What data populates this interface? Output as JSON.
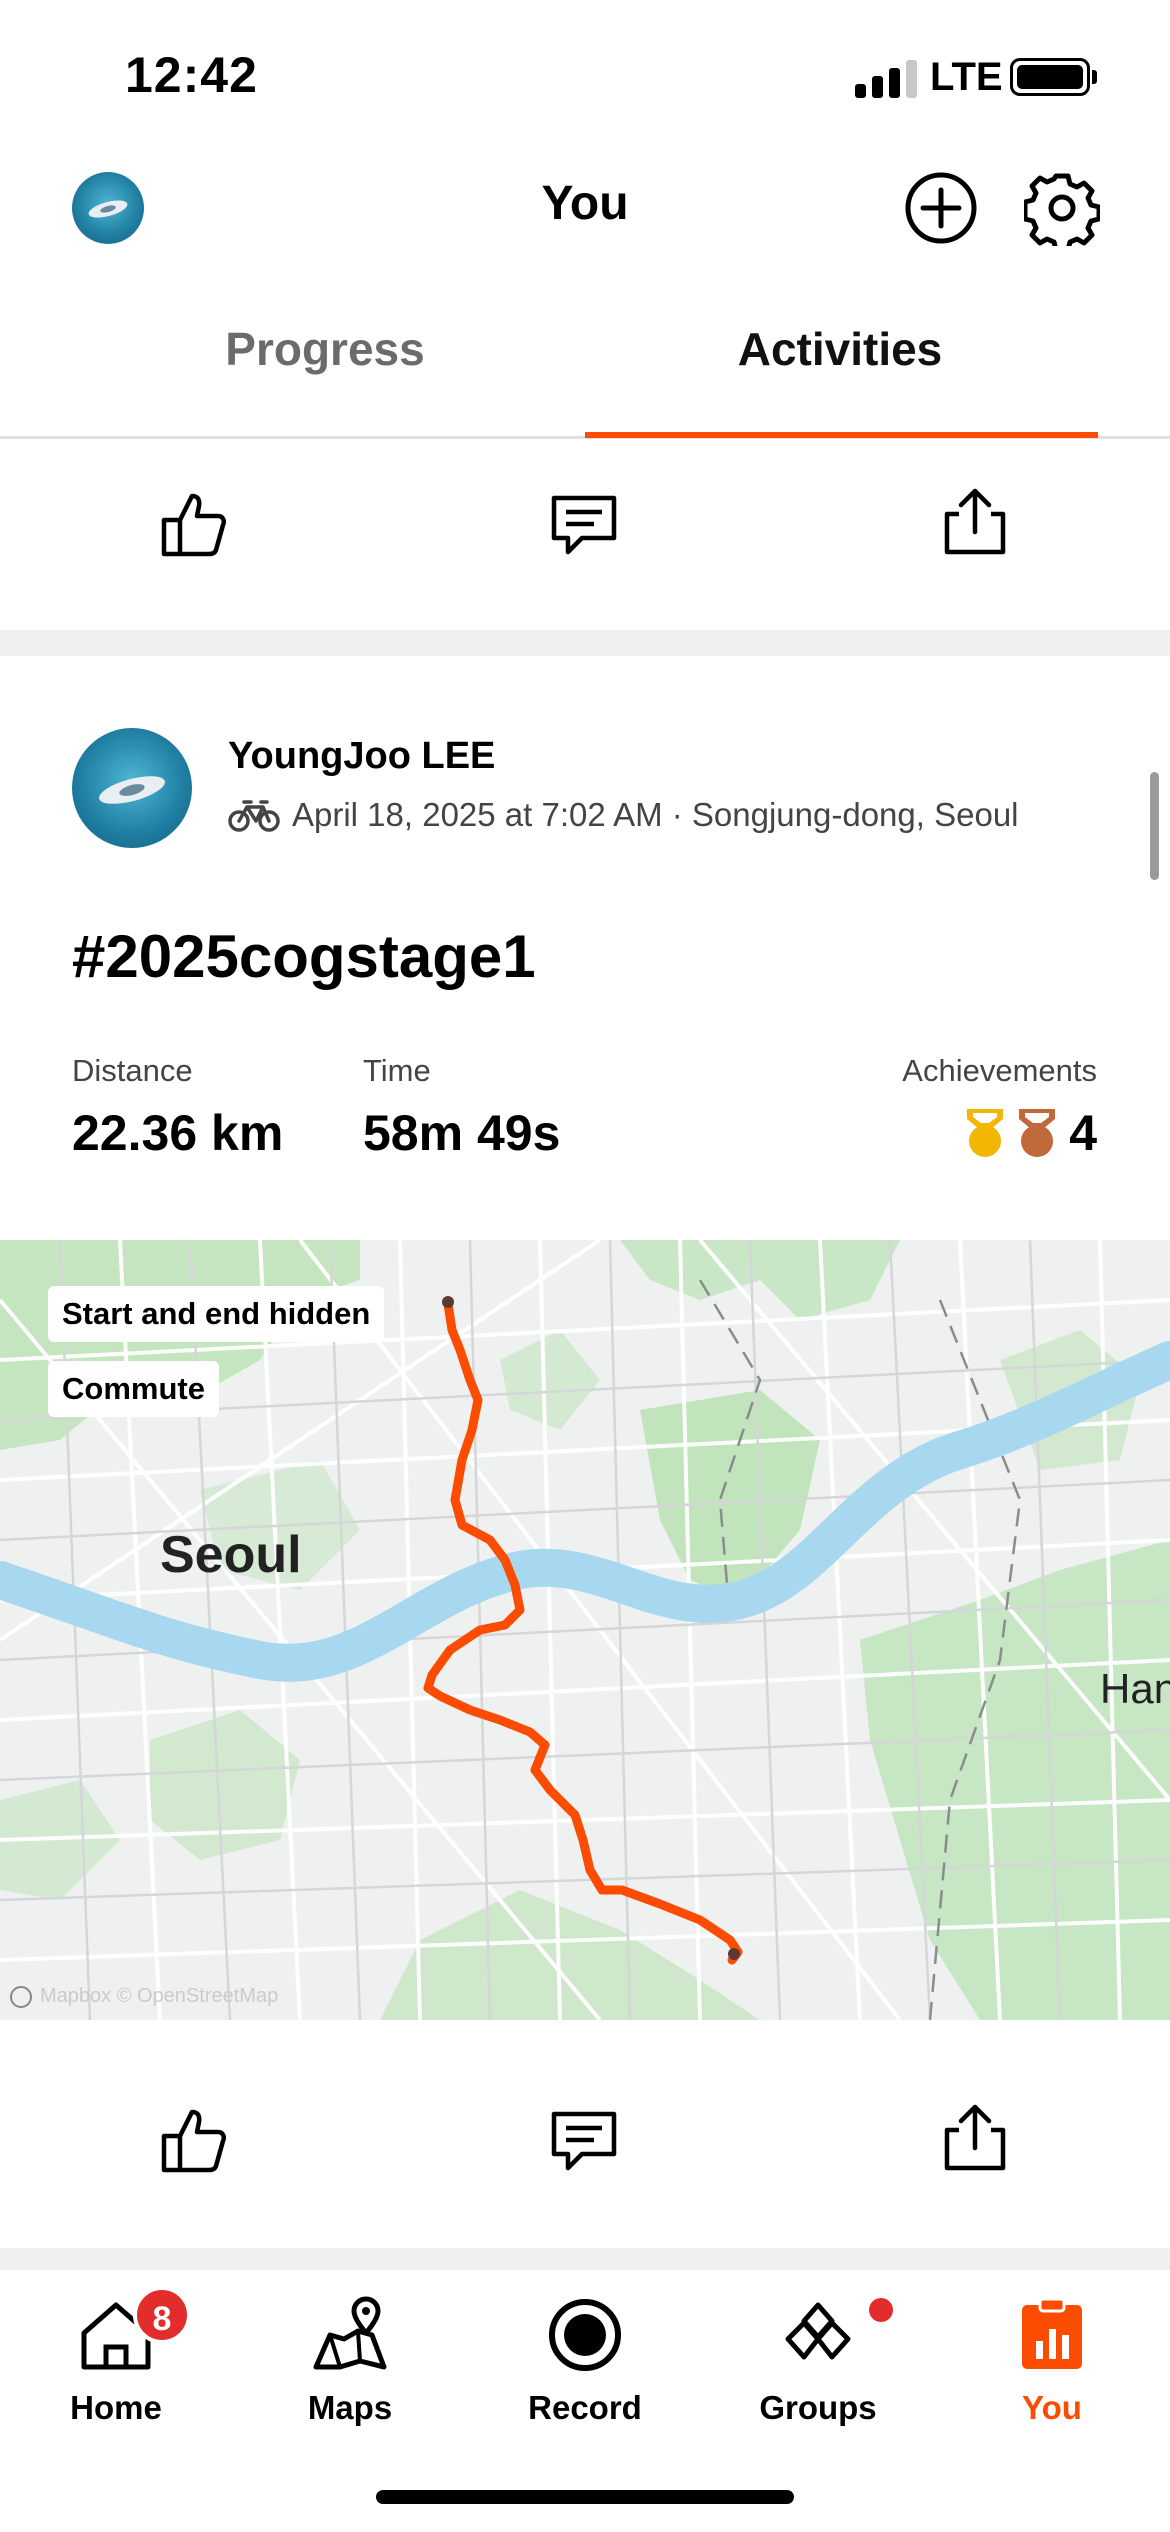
{
  "status_bar": {
    "time": "12:42",
    "network": "LTE"
  },
  "header": {
    "title": "You",
    "add_icon": "plus-circle-icon",
    "settings_icon": "gear-icon"
  },
  "tabs": [
    {
      "label": "Progress",
      "active": false
    },
    {
      "label": "Activities",
      "active": true
    }
  ],
  "activity": {
    "athlete": "YoungJoo LEE",
    "meta": "April 18, 2025 at 7:02 AM · Songjung-dong, Seoul",
    "activity_type_icon": "bike-icon",
    "title": "#2025cogstage1",
    "stats": [
      {
        "label": "Distance",
        "value": "22.36 km"
      },
      {
        "label": "Time",
        "value": "58m 49s"
      }
    ],
    "achievements": {
      "label": "Achievements",
      "count": "4",
      "medals": [
        "gold",
        "bronze"
      ]
    },
    "map": {
      "chips": [
        "Start and end hidden",
        "Commute"
      ],
      "city_label": "Seoul",
      "edge_label": "Han",
      "attribution": "Mapbox © OpenStreetMap"
    }
  },
  "nav": {
    "items": [
      {
        "label": "Home",
        "icon": "home-icon",
        "badge": "8"
      },
      {
        "label": "Maps",
        "icon": "maps-icon"
      },
      {
        "label": "Record",
        "icon": "record-icon"
      },
      {
        "label": "Groups",
        "icon": "groups-icon"
      },
      {
        "label": "You",
        "icon": "you-icon",
        "active": true
      }
    ]
  },
  "colors": {
    "accent": "#fc4c02",
    "badge": "#e32c2c",
    "gold_medal": "#f2b705",
    "bronze_medal": "#c06a3b"
  }
}
